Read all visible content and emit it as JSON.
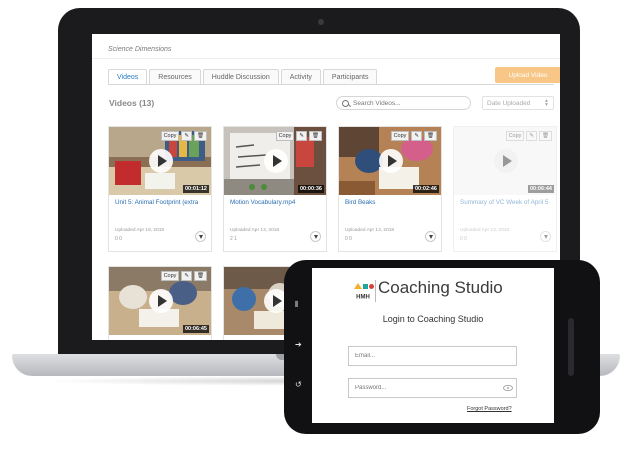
{
  "laptop_app": {
    "course_title": "Science Dimensions",
    "tabs": [
      {
        "label": "Videos",
        "active": true
      },
      {
        "label": "Resources",
        "active": false
      },
      {
        "label": "Huddle Discussion",
        "active": false
      },
      {
        "label": "Activity",
        "active": false
      },
      {
        "label": "Participants",
        "active": false
      }
    ],
    "upload_button": "Upload Video",
    "videos_heading": "Videos (13)",
    "search": {
      "placeholder": "Search Videos..."
    },
    "sort_select": {
      "value": "Date Uploaded"
    },
    "card_tools": {
      "copy": "Copy",
      "edit_icon": "edit-icon",
      "delete_icon": "trash-icon"
    },
    "video_cards": [
      {
        "title": "Unit 5: Animal Footprint (extra",
        "duration": "00:01:12",
        "date": "Uploaded Apr 18, 2018",
        "counts": "0  0",
        "faded": false,
        "thumb": "classroom-red-chair"
      },
      {
        "title": "Motion Vocabulary.mp4",
        "duration": "00:00:36",
        "date": "Uploaded Apr 13, 2018",
        "counts": "2  1",
        "faded": false,
        "thumb": "whiteboard"
      },
      {
        "title": "Bird Beaks",
        "duration": "00:02:46",
        "date": "Uploaded Apr 13, 2018",
        "counts": "0  0",
        "faded": false,
        "thumb": "students-table"
      },
      {
        "title": "Summary of VC Week of April 5",
        "duration": "00:06:44",
        "date": "Uploaded Apr 13, 2018",
        "counts": "0  0",
        "faded": true,
        "thumb": "blank"
      },
      {
        "title": "",
        "duration": "00:06:45",
        "date": "",
        "counts": "",
        "faded": false,
        "thumb": "students-reading"
      },
      {
        "title": "",
        "duration": "",
        "date": "",
        "counts": "",
        "faded": false,
        "thumb": "students-group"
      }
    ]
  },
  "phone_app": {
    "logo_text": "HMH",
    "brand": "Coaching Studio",
    "login_heading": "Login to Coaching Studio",
    "email_placeholder": "Email...",
    "password_placeholder": "Password...",
    "forgot_link": "Forgot Password?"
  },
  "colors": {
    "accent_orange": "#f8c687",
    "link_blue": "#2a6fb3",
    "laptop_bezel": "#1b1b1d",
    "logo_teal": "#1aa7a0",
    "logo_yellow": "#f2b02c",
    "logo_red": "#d9403a"
  }
}
